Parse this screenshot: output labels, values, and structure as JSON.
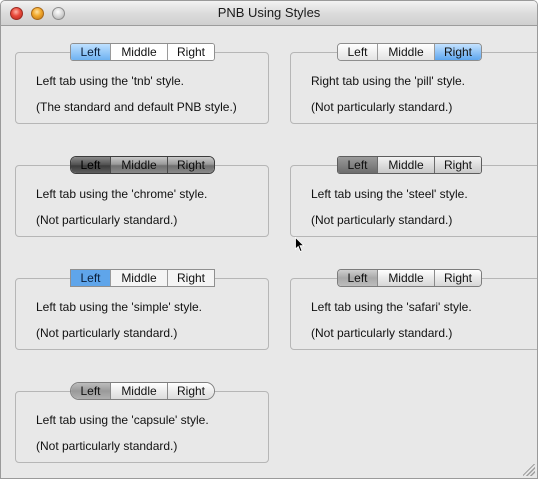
{
  "window": {
    "title": "PNB Using Styles"
  },
  "groups": [
    {
      "style": "tnb",
      "tabs": [
        "Left",
        "Middle",
        "Right"
      ],
      "selected": "Left",
      "line1": "Left tab using the 'tnb' style.",
      "line2": "(The standard and default PNB style.)"
    },
    {
      "style": "pill",
      "tabs": [
        "Left",
        "Middle",
        "Right"
      ],
      "selected": "Right",
      "line1": "Right tab using the 'pill' style.",
      "line2": "(Not particularly standard.)"
    },
    {
      "style": "chrome",
      "tabs": [
        "Left",
        "Middle",
        "Right"
      ],
      "selected": "Left",
      "line1": "Left tab using the 'chrome' style.",
      "line2": "(Not particularly standard.)"
    },
    {
      "style": "steel",
      "tabs": [
        "Left",
        "Middle",
        "Right"
      ],
      "selected": "Left",
      "line1": "Left tab using the 'steel' style.",
      "line2": "(Not particularly standard.)"
    },
    {
      "style": "simple",
      "tabs": [
        "Left",
        "Middle",
        "Right"
      ],
      "selected": "Left",
      "line1": "Left tab using the 'simple' style.",
      "line2": "(Not particularly standard.)"
    },
    {
      "style": "safari",
      "tabs": [
        "Left",
        "Middle",
        "Right"
      ],
      "selected": "Left",
      "line1": "Left tab using the 'safari' style.",
      "line2": "(Not particularly standard.)"
    },
    {
      "style": "capsule",
      "tabs": [
        "Left",
        "Middle",
        "Right"
      ],
      "selected": "Left",
      "line1": "Left tab using the 'capsule' style.",
      "line2": "(Not particularly standard.)"
    }
  ],
  "colors": {
    "window_background": "#e8e8e8",
    "selected_blue": "#6fb2f1",
    "close_button": "#e8483a",
    "minimize_button": "#f1a72a"
  },
  "icons": {
    "close": "close-window-icon",
    "minimize": "minimize-window-icon",
    "zoom": "zoom-window-icon",
    "cursor": "mouse-pointer-icon",
    "resize": "resize-grip-icon"
  }
}
